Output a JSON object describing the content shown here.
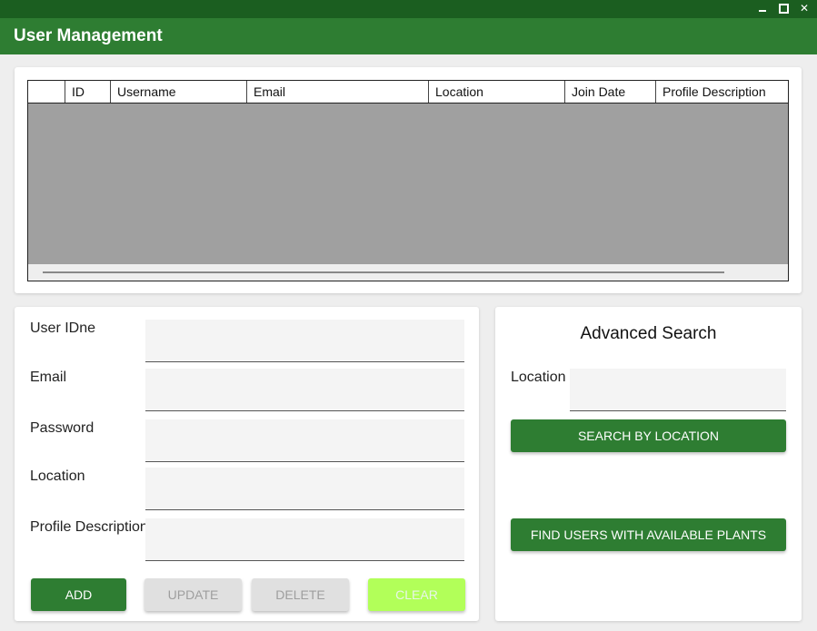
{
  "window": {
    "minimize_glyph": "",
    "maximize_glyph": "",
    "close_glyph": "✕"
  },
  "app": {
    "title": "User Management",
    "primary_color": "#2e7d32",
    "titlebar_color": "#1b5e20"
  },
  "table": {
    "columns": [
      "",
      "ID",
      "Username",
      "Email",
      "Location",
      "Join Date",
      "Profile Description"
    ],
    "rows": []
  },
  "form": {
    "user_id_label": "User IDne",
    "email_label": "Email",
    "password_label": "Password",
    "location_label": "Location",
    "profile_label": "Profile Description",
    "user_id_value": "",
    "email_value": "",
    "password_value": "",
    "location_value": "",
    "profile_value": ""
  },
  "buttons": {
    "add": "ADD",
    "update": "UPDATE",
    "delete": "DELETE",
    "clear": "CLEAR"
  },
  "advanced_search": {
    "title": "Advanced Search",
    "location_label": "Location",
    "location_value": "",
    "search_button": "SEARCH BY LOCATION",
    "find_button": "FIND USERS WITH AVAILABLE PLANTS"
  }
}
